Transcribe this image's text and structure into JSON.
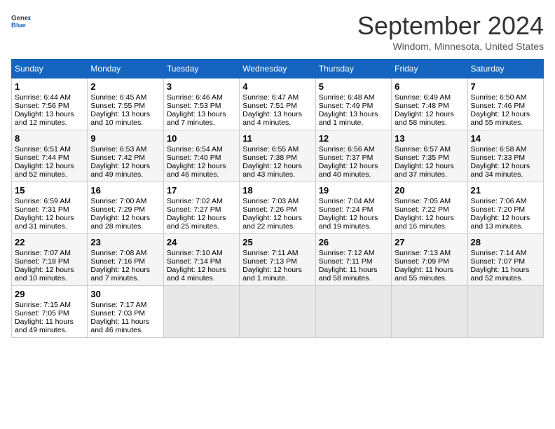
{
  "header": {
    "logo_general": "General",
    "logo_blue": "Blue",
    "title": "September 2024",
    "location": "Windom, Minnesota, United States"
  },
  "days_of_week": [
    "Sunday",
    "Monday",
    "Tuesday",
    "Wednesday",
    "Thursday",
    "Friday",
    "Saturday"
  ],
  "weeks": [
    [
      {
        "day": 1,
        "lines": [
          "Sunrise: 6:44 AM",
          "Sunset: 7:56 PM",
          "Daylight: 13 hours",
          "and 12 minutes."
        ]
      },
      {
        "day": 2,
        "lines": [
          "Sunrise: 6:45 AM",
          "Sunset: 7:55 PM",
          "Daylight: 13 hours",
          "and 10 minutes."
        ]
      },
      {
        "day": 3,
        "lines": [
          "Sunrise: 6:46 AM",
          "Sunset: 7:53 PM",
          "Daylight: 13 hours",
          "and 7 minutes."
        ]
      },
      {
        "day": 4,
        "lines": [
          "Sunrise: 6:47 AM",
          "Sunset: 7:51 PM",
          "Daylight: 13 hours",
          "and 4 minutes."
        ]
      },
      {
        "day": 5,
        "lines": [
          "Sunrise: 6:48 AM",
          "Sunset: 7:49 PM",
          "Daylight: 13 hours",
          "and 1 minute."
        ]
      },
      {
        "day": 6,
        "lines": [
          "Sunrise: 6:49 AM",
          "Sunset: 7:48 PM",
          "Daylight: 12 hours",
          "and 58 minutes."
        ]
      },
      {
        "day": 7,
        "lines": [
          "Sunrise: 6:50 AM",
          "Sunset: 7:46 PM",
          "Daylight: 12 hours",
          "and 55 minutes."
        ]
      }
    ],
    [
      {
        "day": 8,
        "lines": [
          "Sunrise: 6:51 AM",
          "Sunset: 7:44 PM",
          "Daylight: 12 hours",
          "and 52 minutes."
        ]
      },
      {
        "day": 9,
        "lines": [
          "Sunrise: 6:53 AM",
          "Sunset: 7:42 PM",
          "Daylight: 12 hours",
          "and 49 minutes."
        ]
      },
      {
        "day": 10,
        "lines": [
          "Sunrise: 6:54 AM",
          "Sunset: 7:40 PM",
          "Daylight: 12 hours",
          "and 46 minutes."
        ]
      },
      {
        "day": 11,
        "lines": [
          "Sunrise: 6:55 AM",
          "Sunset: 7:38 PM",
          "Daylight: 12 hours",
          "and 43 minutes."
        ]
      },
      {
        "day": 12,
        "lines": [
          "Sunrise: 6:56 AM",
          "Sunset: 7:37 PM",
          "Daylight: 12 hours",
          "and 40 minutes."
        ]
      },
      {
        "day": 13,
        "lines": [
          "Sunrise: 6:57 AM",
          "Sunset: 7:35 PM",
          "Daylight: 12 hours",
          "and 37 minutes."
        ]
      },
      {
        "day": 14,
        "lines": [
          "Sunrise: 6:58 AM",
          "Sunset: 7:33 PM",
          "Daylight: 12 hours",
          "and 34 minutes."
        ]
      }
    ],
    [
      {
        "day": 15,
        "lines": [
          "Sunrise: 6:59 AM",
          "Sunset: 7:31 PM",
          "Daylight: 12 hours",
          "and 31 minutes."
        ]
      },
      {
        "day": 16,
        "lines": [
          "Sunrise: 7:00 AM",
          "Sunset: 7:29 PM",
          "Daylight: 12 hours",
          "and 28 minutes."
        ]
      },
      {
        "day": 17,
        "lines": [
          "Sunrise: 7:02 AM",
          "Sunset: 7:27 PM",
          "Daylight: 12 hours",
          "and 25 minutes."
        ]
      },
      {
        "day": 18,
        "lines": [
          "Sunrise: 7:03 AM",
          "Sunset: 7:26 PM",
          "Daylight: 12 hours",
          "and 22 minutes."
        ]
      },
      {
        "day": 19,
        "lines": [
          "Sunrise: 7:04 AM",
          "Sunset: 7:24 PM",
          "Daylight: 12 hours",
          "and 19 minutes."
        ]
      },
      {
        "day": 20,
        "lines": [
          "Sunrise: 7:05 AM",
          "Sunset: 7:22 PM",
          "Daylight: 12 hours",
          "and 16 minutes."
        ]
      },
      {
        "day": 21,
        "lines": [
          "Sunrise: 7:06 AM",
          "Sunset: 7:20 PM",
          "Daylight: 12 hours",
          "and 13 minutes."
        ]
      }
    ],
    [
      {
        "day": 22,
        "lines": [
          "Sunrise: 7:07 AM",
          "Sunset: 7:18 PM",
          "Daylight: 12 hours",
          "and 10 minutes."
        ]
      },
      {
        "day": 23,
        "lines": [
          "Sunrise: 7:08 AM",
          "Sunset: 7:16 PM",
          "Daylight: 12 hours",
          "and 7 minutes."
        ]
      },
      {
        "day": 24,
        "lines": [
          "Sunrise: 7:10 AM",
          "Sunset: 7:14 PM",
          "Daylight: 12 hours",
          "and 4 minutes."
        ]
      },
      {
        "day": 25,
        "lines": [
          "Sunrise: 7:11 AM",
          "Sunset: 7:13 PM",
          "Daylight: 12 hours",
          "and 1 minute."
        ]
      },
      {
        "day": 26,
        "lines": [
          "Sunrise: 7:12 AM",
          "Sunset: 7:11 PM",
          "Daylight: 11 hours",
          "and 58 minutes."
        ]
      },
      {
        "day": 27,
        "lines": [
          "Sunrise: 7:13 AM",
          "Sunset: 7:09 PM",
          "Daylight: 11 hours",
          "and 55 minutes."
        ]
      },
      {
        "day": 28,
        "lines": [
          "Sunrise: 7:14 AM",
          "Sunset: 7:07 PM",
          "Daylight: 11 hours",
          "and 52 minutes."
        ]
      }
    ],
    [
      {
        "day": 29,
        "lines": [
          "Sunrise: 7:15 AM",
          "Sunset: 7:05 PM",
          "Daylight: 11 hours",
          "and 49 minutes."
        ]
      },
      {
        "day": 30,
        "lines": [
          "Sunrise: 7:17 AM",
          "Sunset: 7:03 PM",
          "Daylight: 11 hours",
          "and 46 minutes."
        ]
      },
      null,
      null,
      null,
      null,
      null
    ]
  ]
}
